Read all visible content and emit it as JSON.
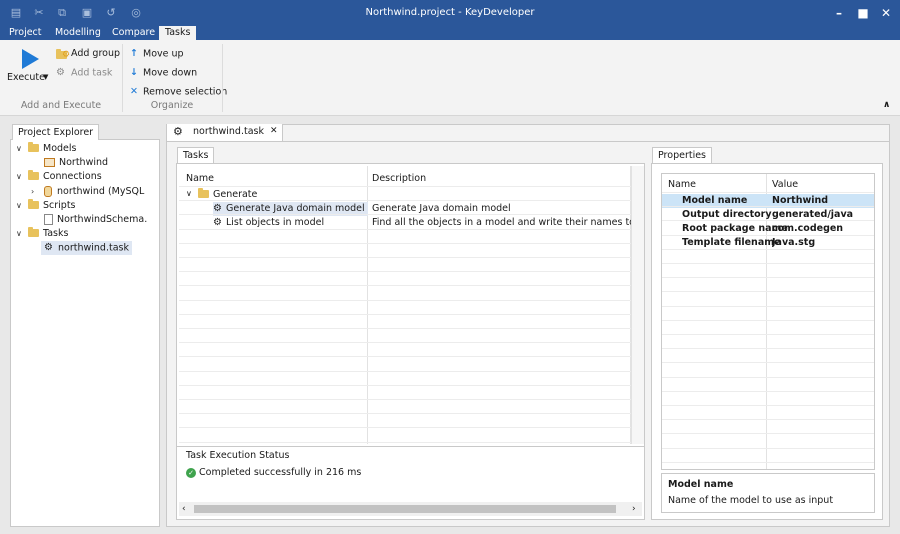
{
  "title": "Northwind.project - KeyDeveloper",
  "quick_access": [
    "save-icon",
    "cut-icon",
    "copy-icon",
    "paste-icon",
    "undo-icon",
    "chat-icon"
  ],
  "menu": [
    "Project",
    "Modelling",
    "Compare",
    "Tasks"
  ],
  "ribbon": {
    "execute_label": "Execute",
    "add_group_label": "Add group",
    "add_task_label": "Add task",
    "group1_label": "Add and Execute",
    "move_up_label": "Move up",
    "move_down_label": "Move down",
    "remove_selection_label": "Remove selection",
    "group2_label": "Organize"
  },
  "explorer": {
    "tab_label": "Project Explorer",
    "models_label": "Models",
    "northwind_model_label": "Northwind",
    "connections_label": "Connections",
    "connection_label": "northwind (MySQL",
    "scripts_label": "Scripts",
    "script_label": "NorthwindSchema.",
    "tasks_label": "Tasks",
    "task_file_label": "northwind.task"
  },
  "editor": {
    "doc_tab_label": "northwind.task",
    "tasks_tab_label": "Tasks",
    "col_name": "Name",
    "col_description": "Description",
    "group_name": "Generate",
    "rows": [
      {
        "name": "Generate Java domain model",
        "description": "Generate Java domain model"
      },
      {
        "name": "List objects in model",
        "description": "Find all the objects in a model and write their names to file"
      }
    ],
    "status_title": "Task Execution Status",
    "status_text": "Completed successfully in 216 ms"
  },
  "properties": {
    "tab_label": "Properties",
    "col_name": "Name",
    "col_value": "Value",
    "rows": [
      {
        "name": "Model name",
        "value": "Northwind"
      },
      {
        "name": "Output directory",
        "value": "generated/java"
      },
      {
        "name": "Root package name",
        "value": "com.codegen"
      },
      {
        "name": "Template filename",
        "value": "Java.stg"
      }
    ],
    "help_title": "Model name",
    "help_text": "Name of the model to use as input"
  },
  "colors": {
    "titlebar": "#2b579a",
    "execute_blue": "#1f7ad6",
    "success_green": "#3fa34d"
  }
}
